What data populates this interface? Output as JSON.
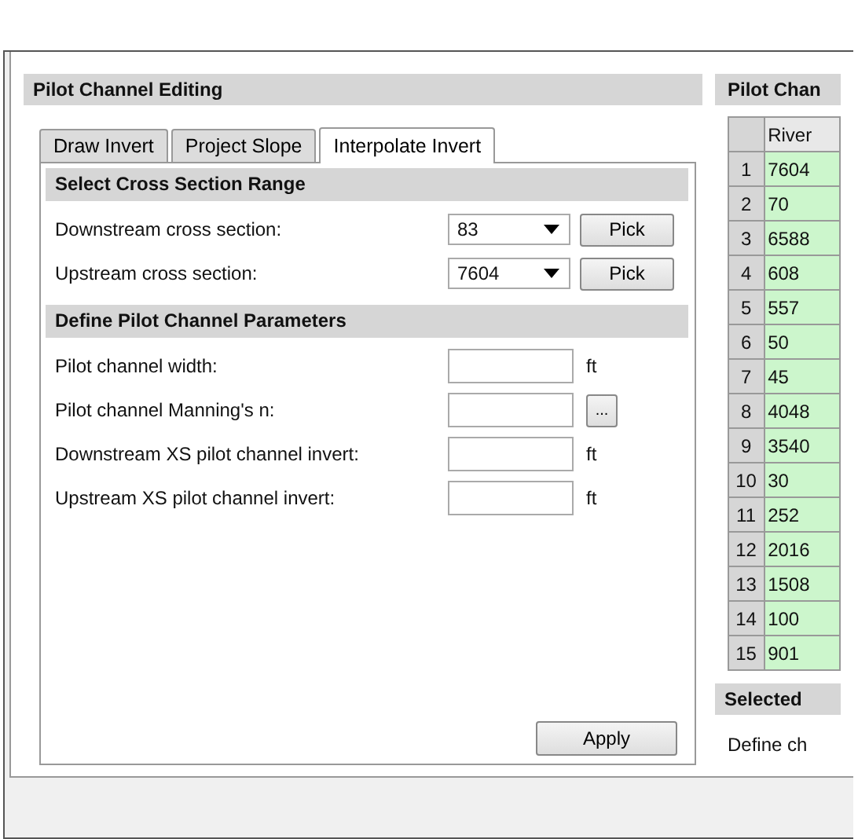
{
  "left_panel": {
    "title": "Pilot Channel Editing",
    "tabs": [
      {
        "label": "Draw Invert",
        "selected": false
      },
      {
        "label": "Project Slope",
        "selected": false
      },
      {
        "label": "Interpolate Invert",
        "selected": true
      }
    ],
    "sections": [
      {
        "title": "Select Cross Section Range",
        "rows": [
          {
            "kind": "dropdown",
            "label": "Downstream cross section:",
            "value": "83",
            "button": "Pick"
          },
          {
            "kind": "dropdown",
            "label": "Upstream cross section:",
            "value": "7604",
            "button": "Pick"
          }
        ]
      },
      {
        "title": "Define Pilot Channel Parameters",
        "rows": [
          {
            "kind": "input",
            "label": "Pilot channel width:",
            "unit": "ft"
          },
          {
            "kind": "browse",
            "label": "Pilot channel Manning's n:",
            "button": "..."
          },
          {
            "kind": "input",
            "label": "Downstream XS pilot channel invert:",
            "unit": "ft"
          },
          {
            "kind": "input",
            "label": "Upstream XS pilot channel invert:",
            "unit": "ft"
          }
        ]
      }
    ],
    "apply_button": "Apply"
  },
  "right_panel": {
    "title": "Pilot Chan",
    "table": {
      "columns": [
        "River"
      ],
      "rows": [
        {
          "index": "1",
          "value": "7604"
        },
        {
          "index": "2",
          "value": "70"
        },
        {
          "index": "3",
          "value": "6588"
        },
        {
          "index": "4",
          "value": "608"
        },
        {
          "index": "5",
          "value": "557"
        },
        {
          "index": "6",
          "value": "50"
        },
        {
          "index": "7",
          "value": "45"
        },
        {
          "index": "8",
          "value": "4048"
        },
        {
          "index": "9",
          "value": "3540"
        },
        {
          "index": "10",
          "value": "30"
        },
        {
          "index": "11",
          "value": "252"
        },
        {
          "index": "12",
          "value": "2016"
        },
        {
          "index": "13",
          "value": "1508"
        },
        {
          "index": "14",
          "value": "100"
        },
        {
          "index": "15",
          "value": "901"
        }
      ]
    },
    "section_title": "Selected",
    "text": "Define ch"
  }
}
